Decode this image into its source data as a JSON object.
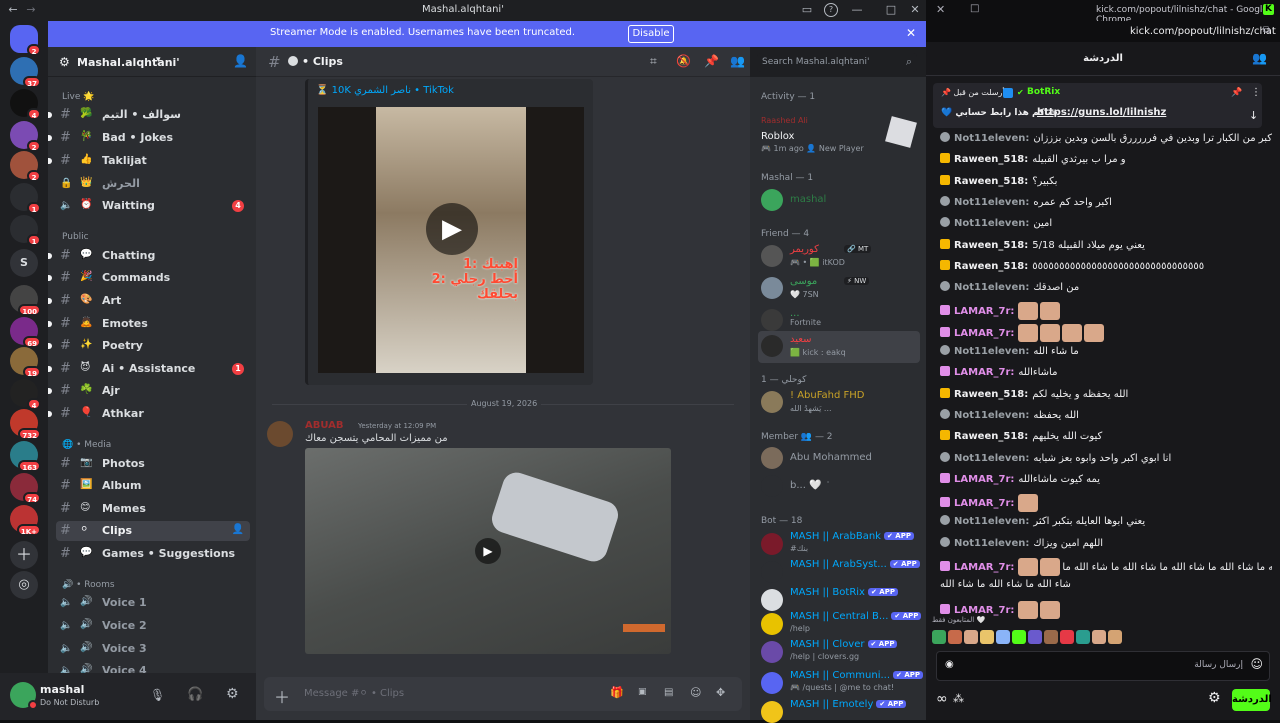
{
  "discord": {
    "window_title": "Mashal.alqhtani'",
    "banner": {
      "message": "Streamer Mode is enabled. Usernames have been truncated.",
      "disable": "Disable"
    },
    "server_badges": [
      "2",
      "37",
      "4",
      "2",
      "2",
      "1",
      "1",
      "",
      "100",
      "69",
      "19",
      "4",
      "732",
      "163",
      "74",
      "1K+"
    ],
    "server_letter": "S",
    "server_name": "Mashal.alqhtani'",
    "categories": {
      "live": "Live 🌟",
      "public": "Public",
      "media": "🌐 • Media",
      "rooms": "🔊 • Rooms"
    },
    "channels": [
      {
        "emoji": "🥦",
        "name": "سوالف • التيم",
        "icon": "#"
      },
      {
        "emoji": "🎋",
        "name": "Bad • Jokes",
        "icon": "#"
      },
      {
        "emoji": "👍",
        "name": "Taklijat",
        "icon": "#"
      },
      {
        "emoji": "👑",
        "name": "الحرش",
        "icon": "lock"
      },
      {
        "emoji": "⏰",
        "name": "Waitting",
        "icon": "voice",
        "badge": "4"
      },
      {
        "emoji": "💬",
        "name": "Chatting",
        "icon": "#"
      },
      {
        "emoji": "🎉",
        "name": "Commands",
        "icon": "#"
      },
      {
        "emoji": "🎨",
        "name": "Art",
        "icon": "#"
      },
      {
        "emoji": "🙇",
        "name": "Emotes",
        "icon": "#"
      },
      {
        "emoji": "✨",
        "name": "Poetry",
        "icon": "#"
      },
      {
        "emoji": "😈",
        "name": "Ai • Assistance",
        "icon": "#",
        "badge": "1"
      },
      {
        "emoji": "☘️",
        "name": "Ajr",
        "icon": "#"
      },
      {
        "emoji": "🎈",
        "name": "Athkar",
        "icon": "#"
      },
      {
        "emoji": "📷",
        "name": "Photos",
        "icon": "#"
      },
      {
        "emoji": "🖼️",
        "name": "Album",
        "icon": "#"
      },
      {
        "emoji": "😊",
        "name": "Memes",
        "icon": "#"
      },
      {
        "emoji": "⚪",
        "name": "Clips",
        "icon": "#"
      },
      {
        "emoji": "💬",
        "name": "Games • Suggestions",
        "icon": "#"
      },
      {
        "emoji": "🔊",
        "name": "Voice 1",
        "icon": "voice"
      },
      {
        "emoji": "🔊",
        "name": "Voice 2",
        "icon": "voice"
      },
      {
        "emoji": "🔊",
        "name": "Voice 3",
        "icon": "voice"
      },
      {
        "emoji": "🔊",
        "name": "Voice 4",
        "icon": "voice"
      }
    ],
    "user": {
      "name": "mashal",
      "status": "Do Not Disturb"
    },
    "chat": {
      "channel": "• Clips",
      "search_placeholder": "Search Mashal.alqhtani'",
      "embed_link": "⏳ 10K ناصر الشمري • TikTok",
      "video1_caption": "1: اهبتك\n2: أحط رجلي بحلقك",
      "date_divider": "August 19, 2026",
      "msg_author": "ABUAB",
      "msg_time": "Yesterday at 12:09 PM",
      "msg_text": "من مميزات المحامي يتسجن معاك",
      "input_placeholder": "Message #⚪ • Clips"
    },
    "members": {
      "activity_header": "Activity — 1",
      "activity_user": "Raashed Ali",
      "activity_game": "Roblox",
      "activity_time": "🎮 1m ago  👤 New Player",
      "mashal_header": "Mashal — 1",
      "mashal_name": "mashal",
      "friend_header": "Friend — 4",
      "friends": [
        {
          "name": "كوريمر",
          "tag": "🔗 MT",
          "sub": "🎮 • 🟩 itKOD",
          "color": "#f23f43"
        },
        {
          "name": "موسى",
          "tag": "⚡ NW",
          "sub": "🤍 7SN",
          "color": "#3ba55c"
        },
        {
          "name": "...",
          "tag": "",
          "sub": "Fortnite",
          "color": "#3ba55c"
        },
        {
          "name": "سعيد",
          "tag": "",
          "sub": "🟩 kick : eakq",
          "color": "#f23f43"
        }
      ],
      "koh_header": "كوحلي — 1",
      "abufahd": "! AbuFahd FHD",
      "abufahd_sub": "يَشهدُ الله ... ",
      "member_header": "Member 👥 — 2",
      "members": [
        {
          "name": "Abu Mohammed"
        },
        {
          "name": "b... 🤍 ݁  ݁"
        }
      ],
      "bot_header": "Bot — 18",
      "bots": [
        {
          "name": "MASH || ArabBank",
          "sub": "#بنك"
        },
        {
          "name": "MASH || ArabSyst...",
          "sub": ""
        },
        {
          "name": "MASH || BotRix",
          "sub": ""
        },
        {
          "name": "MASH || Central B...",
          "sub": "/help"
        },
        {
          "name": "MASH || Clover",
          "sub": "/help | clovers.gg"
        },
        {
          "name": "MASH || Communi...",
          "sub": "🎮 /quests | @me to chat!"
        },
        {
          "name": "MASH || Emotely",
          "sub": ""
        }
      ],
      "app_badge": "✔ APP"
    }
  },
  "kick": {
    "window_title": "kick.com/popout/lilnishz/chat - Google Chrome",
    "url": "kick.com/popout/lilnishz/chat",
    "header_title": "الدردشة",
    "pinned": {
      "by": "📌 أرسلت من قبل",
      "user": "BotRix",
      "text": "💙 حياكم هذا رابط حسابي",
      "link": "https://guns.lol/lilnishz"
    },
    "messages": [
      {
        "user": "Not11eleven:",
        "text": "اكبر من الكبار ترا وبدين في فرررررق بالسن وبدين بزززان",
        "color": "#9aa0a6",
        "icon": "#9aa0a6"
      },
      {
        "user": "Raween_518:",
        "text": "و مرا ب بيرثدي القبيله",
        "color": "#efeff1",
        "icon": "#f5b700"
      },
      {
        "user": "Raween_518:",
        "text": "بكبير؟",
        "color": "#efeff1",
        "icon": "#f5b700"
      },
      {
        "user": "Not11eleven:",
        "text": "اكبر واحد كم عمره",
        "color": "#9aa0a6",
        "icon": "#9aa0a6"
      },
      {
        "user": "Not11eleven:",
        "text": "امين",
        "color": "#9aa0a6",
        "icon": "#9aa0a6"
      },
      {
        "user": "Raween_518:",
        "text": "يعني يوم ميلاد القبيله 5/18",
        "color": "#efeff1",
        "icon": "#f5b700"
      },
      {
        "user": "Raween_518:",
        "text": "٥٥٥٥٥٥٥٥٥٥٥٥٥٥٥٥٥٥٥٥٥٥٥٥٥٥٥٥٥٥٥٥",
        "color": "#efeff1",
        "icon": "#f5b700"
      },
      {
        "user": "Not11eleven:",
        "text": "من اصدقك",
        "color": "#9aa0a6",
        "icon": "#9aa0a6"
      },
      {
        "user": "LAMAR_7r:",
        "text": "",
        "color": "#e08ee8",
        "icon": "#e08ee8",
        "emotes": 2
      },
      {
        "user": "LAMAR_7r:",
        "text": "",
        "color": "#e08ee8",
        "icon": "#e08ee8",
        "emotes": 4
      },
      {
        "user": "Not11eleven:",
        "text": "ما شاء الله",
        "color": "#9aa0a6",
        "icon": "#9aa0a6"
      },
      {
        "user": "LAMAR_7r:",
        "text": "ماشاءالله",
        "color": "#e08ee8",
        "icon": "#e08ee8"
      },
      {
        "user": "Raween_518:",
        "text": "الله يحفظه و يخليه لكم",
        "color": "#efeff1",
        "icon": "#f5b700"
      },
      {
        "user": "Not11eleven:",
        "text": "الله يحفظه",
        "color": "#9aa0a6",
        "icon": "#9aa0a6"
      },
      {
        "user": "Raween_518:",
        "text": "كيوت الله يخليهم",
        "color": "#efeff1",
        "icon": "#f5b700"
      },
      {
        "user": "Not11eleven:",
        "text": "انا ابوي اكبر واحد وابوه بعز شبابه",
        "color": "#9aa0a6",
        "icon": "#9aa0a6"
      },
      {
        "user": "LAMAR_7r:",
        "text": "يمه كيوت ماشاءالله",
        "color": "#e08ee8",
        "icon": "#e08ee8"
      },
      {
        "user": "LAMAR_7r:",
        "text": "",
        "color": "#e08ee8",
        "icon": "#e08ee8",
        "emotes": 1
      },
      {
        "user": "Not11eleven:",
        "text": "يعني ابوها العايله بتكبر اكثر",
        "color": "#9aa0a6",
        "icon": "#9aa0a6"
      },
      {
        "user": "Not11eleven:",
        "text": "اللهم امين ويزاك",
        "color": "#9aa0a6",
        "icon": "#9aa0a6"
      },
      {
        "user": "LAMAR_7r:",
        "text": "ما شاء الله ما شاء الله ما شاء الله ما شاء الله ما شاء الله ما",
        "color": "#e08ee8",
        "icon": "#e08ee8",
        "emotes": 2
      },
      {
        "user": "",
        "text": "شاء الله ما شاء الله ما شاء الله",
        "color": "#e08ee8",
        "icon": ""
      },
      {
        "user": "LAMAR_7r:",
        "text": "",
        "color": "#e08ee8",
        "icon": "#e08ee8",
        "emotes": 2
      }
    ],
    "supporters_label": "المتابعون فقط 🤍",
    "input_placeholder": "إرسال رسالة",
    "send_label": "الدردشة"
  }
}
